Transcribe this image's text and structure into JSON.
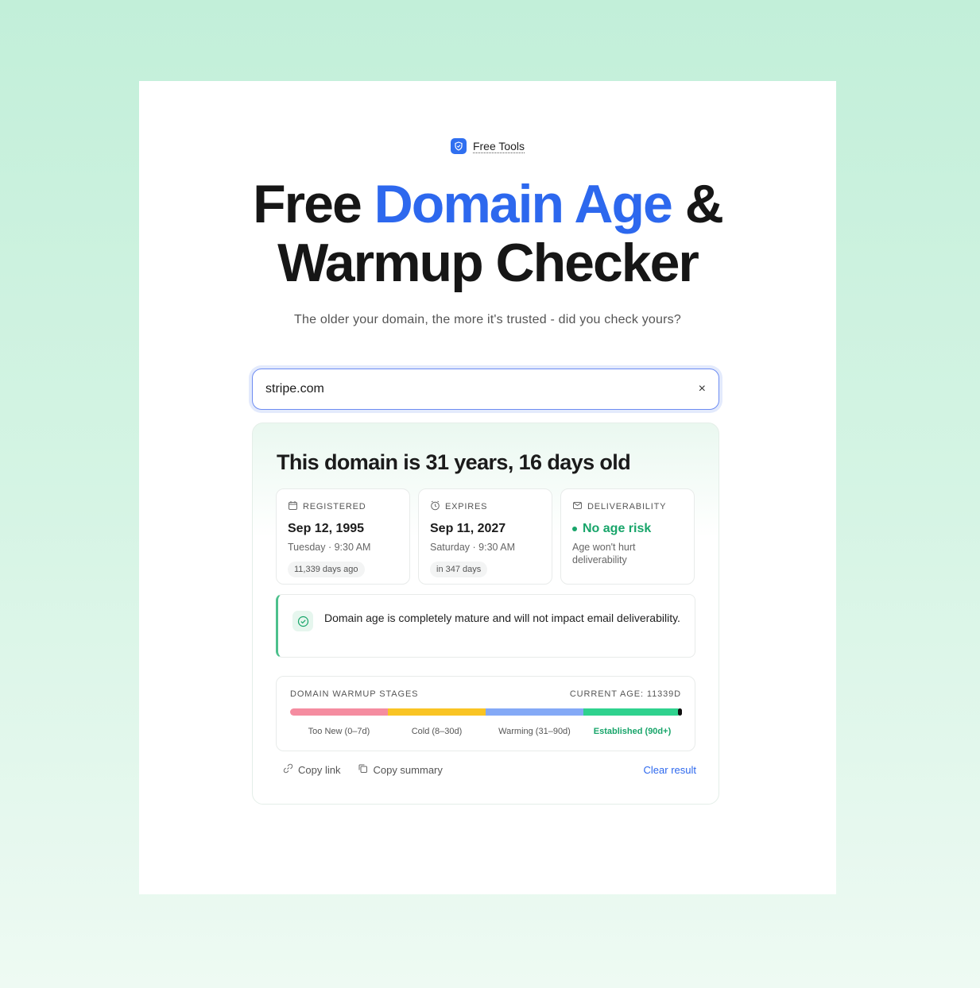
{
  "badge": {
    "label": "Free Tools"
  },
  "hero": {
    "title_part1": "Free ",
    "title_accent": "Domain Age",
    "title_part2": " &",
    "title_line2": "Warmup Checker",
    "subtitle": "The older your domain, the more it's trusted - did you check yours?"
  },
  "search": {
    "value": "stripe.com",
    "clear_icon": "×"
  },
  "result": {
    "headline": "This domain is 31 years, 16 days old",
    "registered": {
      "label": "REGISTERED",
      "date": "Sep 12, 1995",
      "detail": "Tuesday · 9:30 AM",
      "pill": "11,339 days ago"
    },
    "expires": {
      "label": "EXPIRES",
      "date": "Sep 11, 2027",
      "detail": "Saturday · 9:30 AM",
      "pill": "in 347 days"
    },
    "deliverability": {
      "label": "DELIVERABILITY",
      "status": "No age risk",
      "detail": "Age won't hurt deliverability"
    },
    "notice": "Domain age is completely mature and will not impact email deliverability.",
    "stages": {
      "title": "DOMAIN WARMUP STAGES",
      "current": "CURRENT AGE: 11339D",
      "items": [
        {
          "label": "Too New (0–7d)",
          "color": "#f58ca0"
        },
        {
          "label": "Cold (8–30d)",
          "color": "#f9c424"
        },
        {
          "label": "Warming (31–90d)",
          "color": "#84a9f6"
        },
        {
          "label": "Established (90d+)",
          "color": "#2fd28e"
        }
      ]
    },
    "actions": {
      "copy_link": "Copy link",
      "copy_summary": "Copy summary",
      "clear": "Clear result"
    }
  },
  "colors": {
    "accent": "#2d68ee",
    "success": "#18a56a"
  }
}
